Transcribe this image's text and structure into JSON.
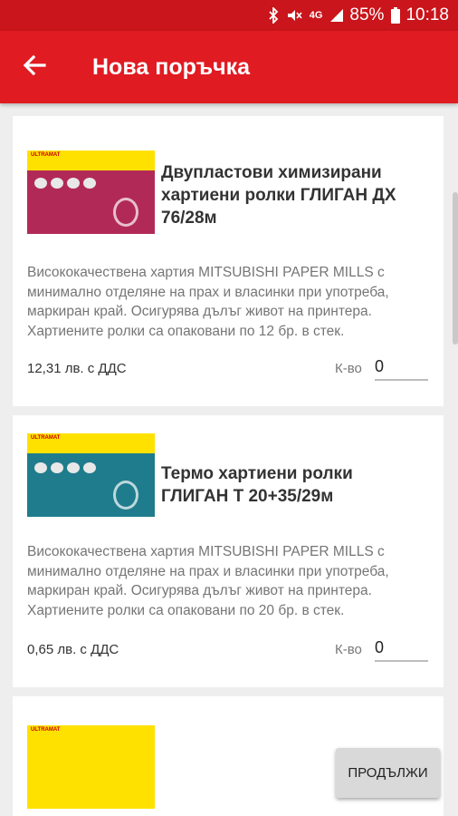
{
  "status_bar": {
    "network": "4G",
    "battery": "85%",
    "time": "10:18"
  },
  "app_bar": {
    "title": "Нова поръчка"
  },
  "products": [
    {
      "brand_label": "ULTRAMAT",
      "image_color": "#b12a57",
      "title": "Двупластови химизирани хартиени ролки ГЛИГАН ДХ 76/28м",
      "description": "Висококачествена хартия MITSUBISHI PAPER MILLS с минимално отделяне на прах и власинки при употреба, маркиран край. Осигурява дълъг живот на принтера. Хартиените ролки са опаковани по 12 бр. в стек.",
      "price": "12,31 лв. с ДДС",
      "qty_label": "К-во",
      "qty_value": "0"
    },
    {
      "brand_label": "ULTRAMAT",
      "image_color": "#1f7c8c",
      "title": "Термо хартиени ролки ГЛИГАН Т 20+35/29м",
      "description": "Висококачествена хартия MITSUBISHI PAPER MILLS с минимално отделяне на прах и власинки при употреба, маркиран край. Осигурява дълъг живот на принтера. Хартиените ролки са опаковани по 20 бр. в стек.",
      "price": "0,65 лв. с ДДС",
      "qty_label": "К-во",
      "qty_value": "0"
    },
    {
      "brand_label": "ULTRAMAT"
    }
  ],
  "continue_button": {
    "label": "ПРОДЪЛЖИ"
  }
}
